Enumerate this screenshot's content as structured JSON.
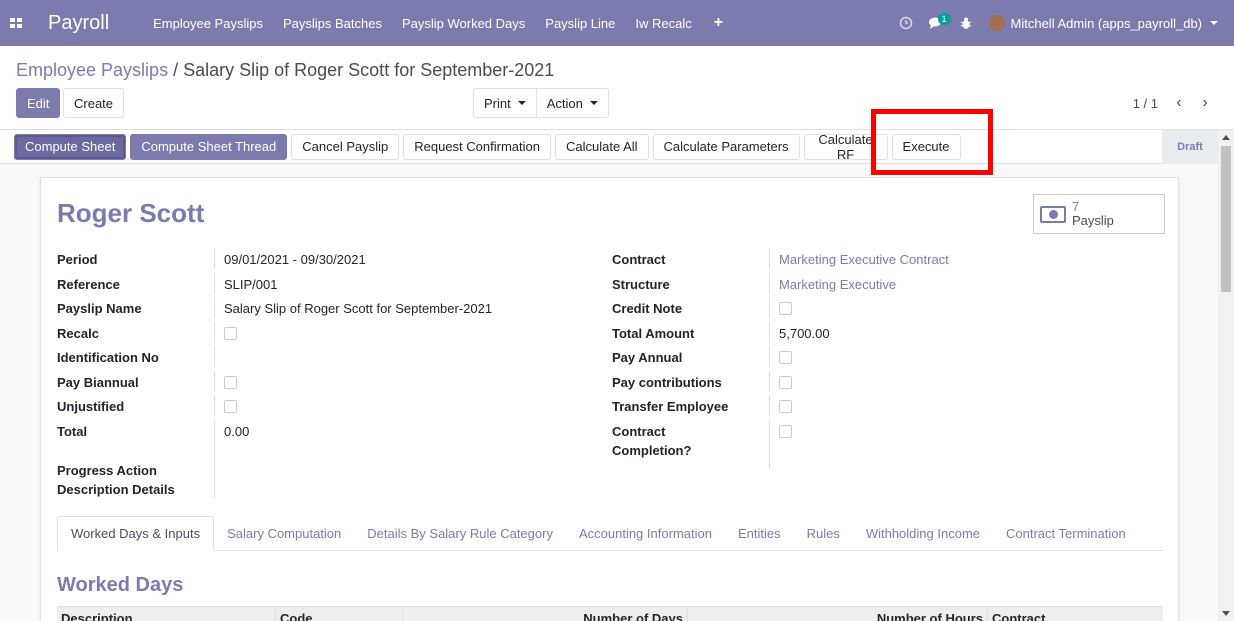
{
  "navbar": {
    "brand": "Payroll",
    "menu": [
      "Employee Payslips",
      "Payslips Batches",
      "Payslip Worked Days",
      "Payslip Line",
      "Iw Recalc"
    ],
    "plus": "+",
    "messages_count": "1",
    "user": "Mitchell Admin (apps_payroll_db)",
    "accent_color": "#7c7bad"
  },
  "breadcrumb": {
    "parent": "Employee Payslips",
    "separator": " / ",
    "current": "Salary Slip of Roger Scott for September-2021"
  },
  "controls": {
    "edit": "Edit",
    "create": "Create",
    "print": "Print",
    "action": "Action",
    "pager": "1 / 1"
  },
  "statusbar": {
    "buttons": [
      "Compute Sheet",
      "Compute Sheet Thread",
      "Cancel Payslip",
      "Request Confirmation",
      "Calculate All",
      "Calculate Parameters",
      "Calculate RF",
      "Execute"
    ],
    "state": "Draft"
  },
  "sheet": {
    "employee_name": "Roger Scott",
    "stat_button": {
      "value": "7",
      "label": "Payslip"
    },
    "left_fields": {
      "period_label": "Period",
      "period_value": "09/01/2021 - 09/30/2021",
      "reference_label": "Reference",
      "reference_value": "SLIP/001",
      "payslip_name_label": "Payslip Name",
      "payslip_name_value": "Salary Slip of Roger Scott for September-2021",
      "recalc_label": "Recalc",
      "identification_label": "Identification No",
      "pay_biannual_label": "Pay Biannual",
      "unjustified_label": "Unjustified",
      "total_label": "Total",
      "total_value": "0.00",
      "progress_label": "Progress Action Description Details"
    },
    "right_fields": {
      "contract_label": "Contract",
      "contract_value": "Marketing Executive Contract",
      "structure_label": "Structure",
      "structure_value": "Marketing Executive",
      "credit_note_label": "Credit Note",
      "total_amount_label": "Total Amount",
      "total_amount_value": "5,700.00",
      "pay_annual_label": "Pay Annual",
      "pay_contributions_label": "Pay contributions",
      "transfer_employee_label": "Transfer Employee",
      "contract_completion_label": "Contract Completion?"
    },
    "tabs": [
      "Worked Days & Inputs",
      "Salary Computation",
      "Details By Salary Rule Category",
      "Accounting Information",
      "Entities",
      "Rules",
      "Withholding Income",
      "Contract Termination"
    ],
    "section_title": "Worked Days",
    "table_headers": [
      "Description",
      "Code",
      "Number of Days",
      "Number of Hours",
      "Contract"
    ]
  }
}
